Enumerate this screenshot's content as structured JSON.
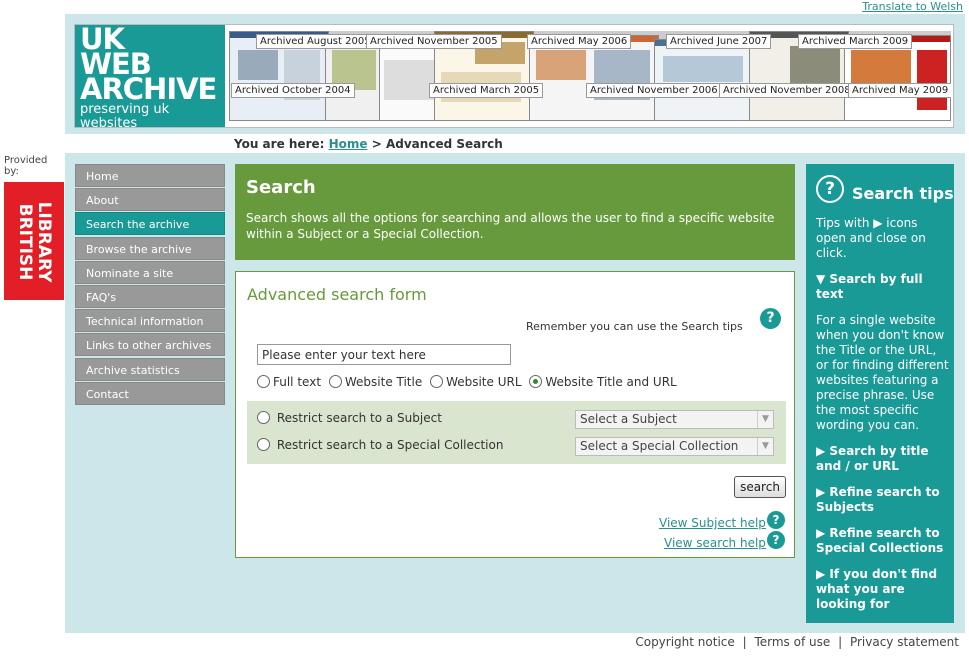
{
  "translate_link": "Translate to Welsh",
  "logo": {
    "line1": "UK",
    "line2": "WEB",
    "line3": "ARCHIVE",
    "tagline": "preserving uk websites"
  },
  "archive_labels": [
    "Archived August 2005",
    "Archived November 2005",
    "Archived May 2006",
    "Archived June 2007",
    "Archived March 2009",
    "Archived October 2004",
    "Archived March 2005",
    "Archived November 2006",
    "Archived November 2008",
    "Archived May 2009"
  ],
  "breadcrumb": {
    "prefix": "You are here:",
    "home": "Home",
    "separator": ">",
    "current": "Advanced Search"
  },
  "provided_by": "Provided by:",
  "british_library": {
    "line1": "BRITISH",
    "line2": "LIBRARY"
  },
  "nav": [
    "Home",
    "About",
    "Search the archive",
    "Browse the archive",
    "Nominate a site",
    "FAQ's",
    "Technical information",
    "Links to other archives",
    "Archive statistics",
    "Contact"
  ],
  "nav_active": "Search the archive",
  "search_header": {
    "title": "Search",
    "description": "Search shows all the options for searching and allows the user to find a specific website within a Subject or a Special Collection."
  },
  "form": {
    "title": "Advanced search form",
    "remember": "Remember you can use the Search tips",
    "input_value": "Please enter your text here",
    "radios": [
      "Full text",
      "Website Title",
      "Website URL",
      "Website Title and URL"
    ],
    "selected_radio": "Website Title and URL",
    "restrict_subject": "Restrict search to a Subject",
    "select_subject": "Select a Subject",
    "restrict_collection": "Restrict search to a Special Collection",
    "select_collection": "Select a Special Collection",
    "search_button": "search",
    "subject_help": "View Subject help",
    "search_help": "View search help"
  },
  "tips": {
    "title": "Search tips",
    "intro": "Tips with ▶ icons open and close on click.",
    "full_text_head": "▼ Search by full text",
    "full_text_body": "For a single website when you don't know the Title or the URL, or for finding different websites featuring a precise phrase. Use the most specific wording you can.",
    "items": [
      "▶ Search by title and / or URL",
      "▶ Refine search to Subjects",
      "▶ Refine search to Special Collections",
      "▶ If you don't find what you are looking for"
    ]
  },
  "footer": {
    "copyright": "Copyright notice",
    "terms": "Terms of use",
    "privacy": "Privacy statement",
    "sep": "|"
  },
  "colors": {
    "teal": "#1a9a96",
    "green": "#669a3c",
    "light_blue": "#cde6ea",
    "bl_red": "#e21e26",
    "nav_gray": "#999999"
  },
  "icons": [
    "help-question-icon",
    "triangle-right-icon",
    "triangle-down-icon",
    "radio-icon",
    "dropdown-arrow-icon"
  ]
}
